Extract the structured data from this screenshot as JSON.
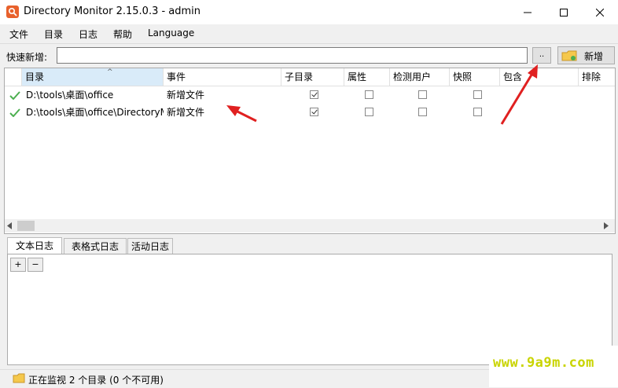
{
  "window": {
    "title": "Directory Monitor 2.15.0.3 - admin"
  },
  "menu": [
    "文件",
    "目录",
    "日志",
    "帮助",
    "Language"
  ],
  "quick_add": {
    "label": "快速新增:",
    "value": "",
    "browse_label": "..",
    "add_label": "新增"
  },
  "grid": {
    "columns": [
      "目录",
      "事件",
      "子目录",
      "属性",
      "检测用户",
      "快照",
      "包含",
      "排除"
    ],
    "rows": [
      {
        "path": "D:\\tools\\桌面\\office",
        "event": "新增文件",
        "subdir": true,
        "attr": false,
        "user": false,
        "snapshot": false
      },
      {
        "path": "D:\\tools\\桌面\\office\\DirectoryMoni...",
        "event": "新增文件",
        "subdir": true,
        "attr": false,
        "user": false,
        "snapshot": false
      }
    ]
  },
  "log_tabs": [
    "文本日志",
    "表格式日志",
    "活动日志"
  ],
  "log_buttons": {
    "expand": "+",
    "collapse": "−"
  },
  "status": {
    "text": "正在监视 2 个目录 (0 个不可用)"
  },
  "watermark": {
    "text": "www.9a9m.com"
  },
  "colors": {
    "accent": "#e8612c",
    "arrow": "#e02020",
    "check": "#4caf50"
  }
}
